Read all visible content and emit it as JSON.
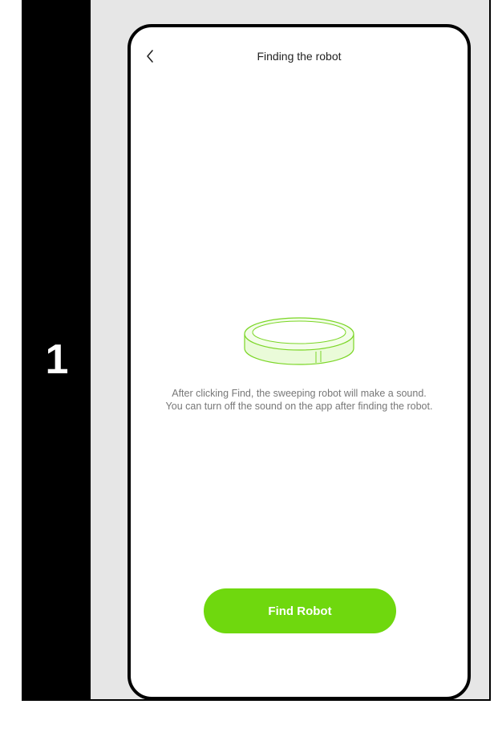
{
  "step": {
    "number": "1"
  },
  "header": {
    "title": "Finding the robot",
    "back_icon": "chevron-left"
  },
  "illustration": {
    "name": "robot-vacuum",
    "color": "#6fd80e"
  },
  "main": {
    "description": "After clicking Find, the sweeping robot will make a sound. You can turn off the sound on the app after finding the robot."
  },
  "actions": {
    "find_button_label": "Find Robot",
    "find_button_color": "#6fd80e"
  }
}
